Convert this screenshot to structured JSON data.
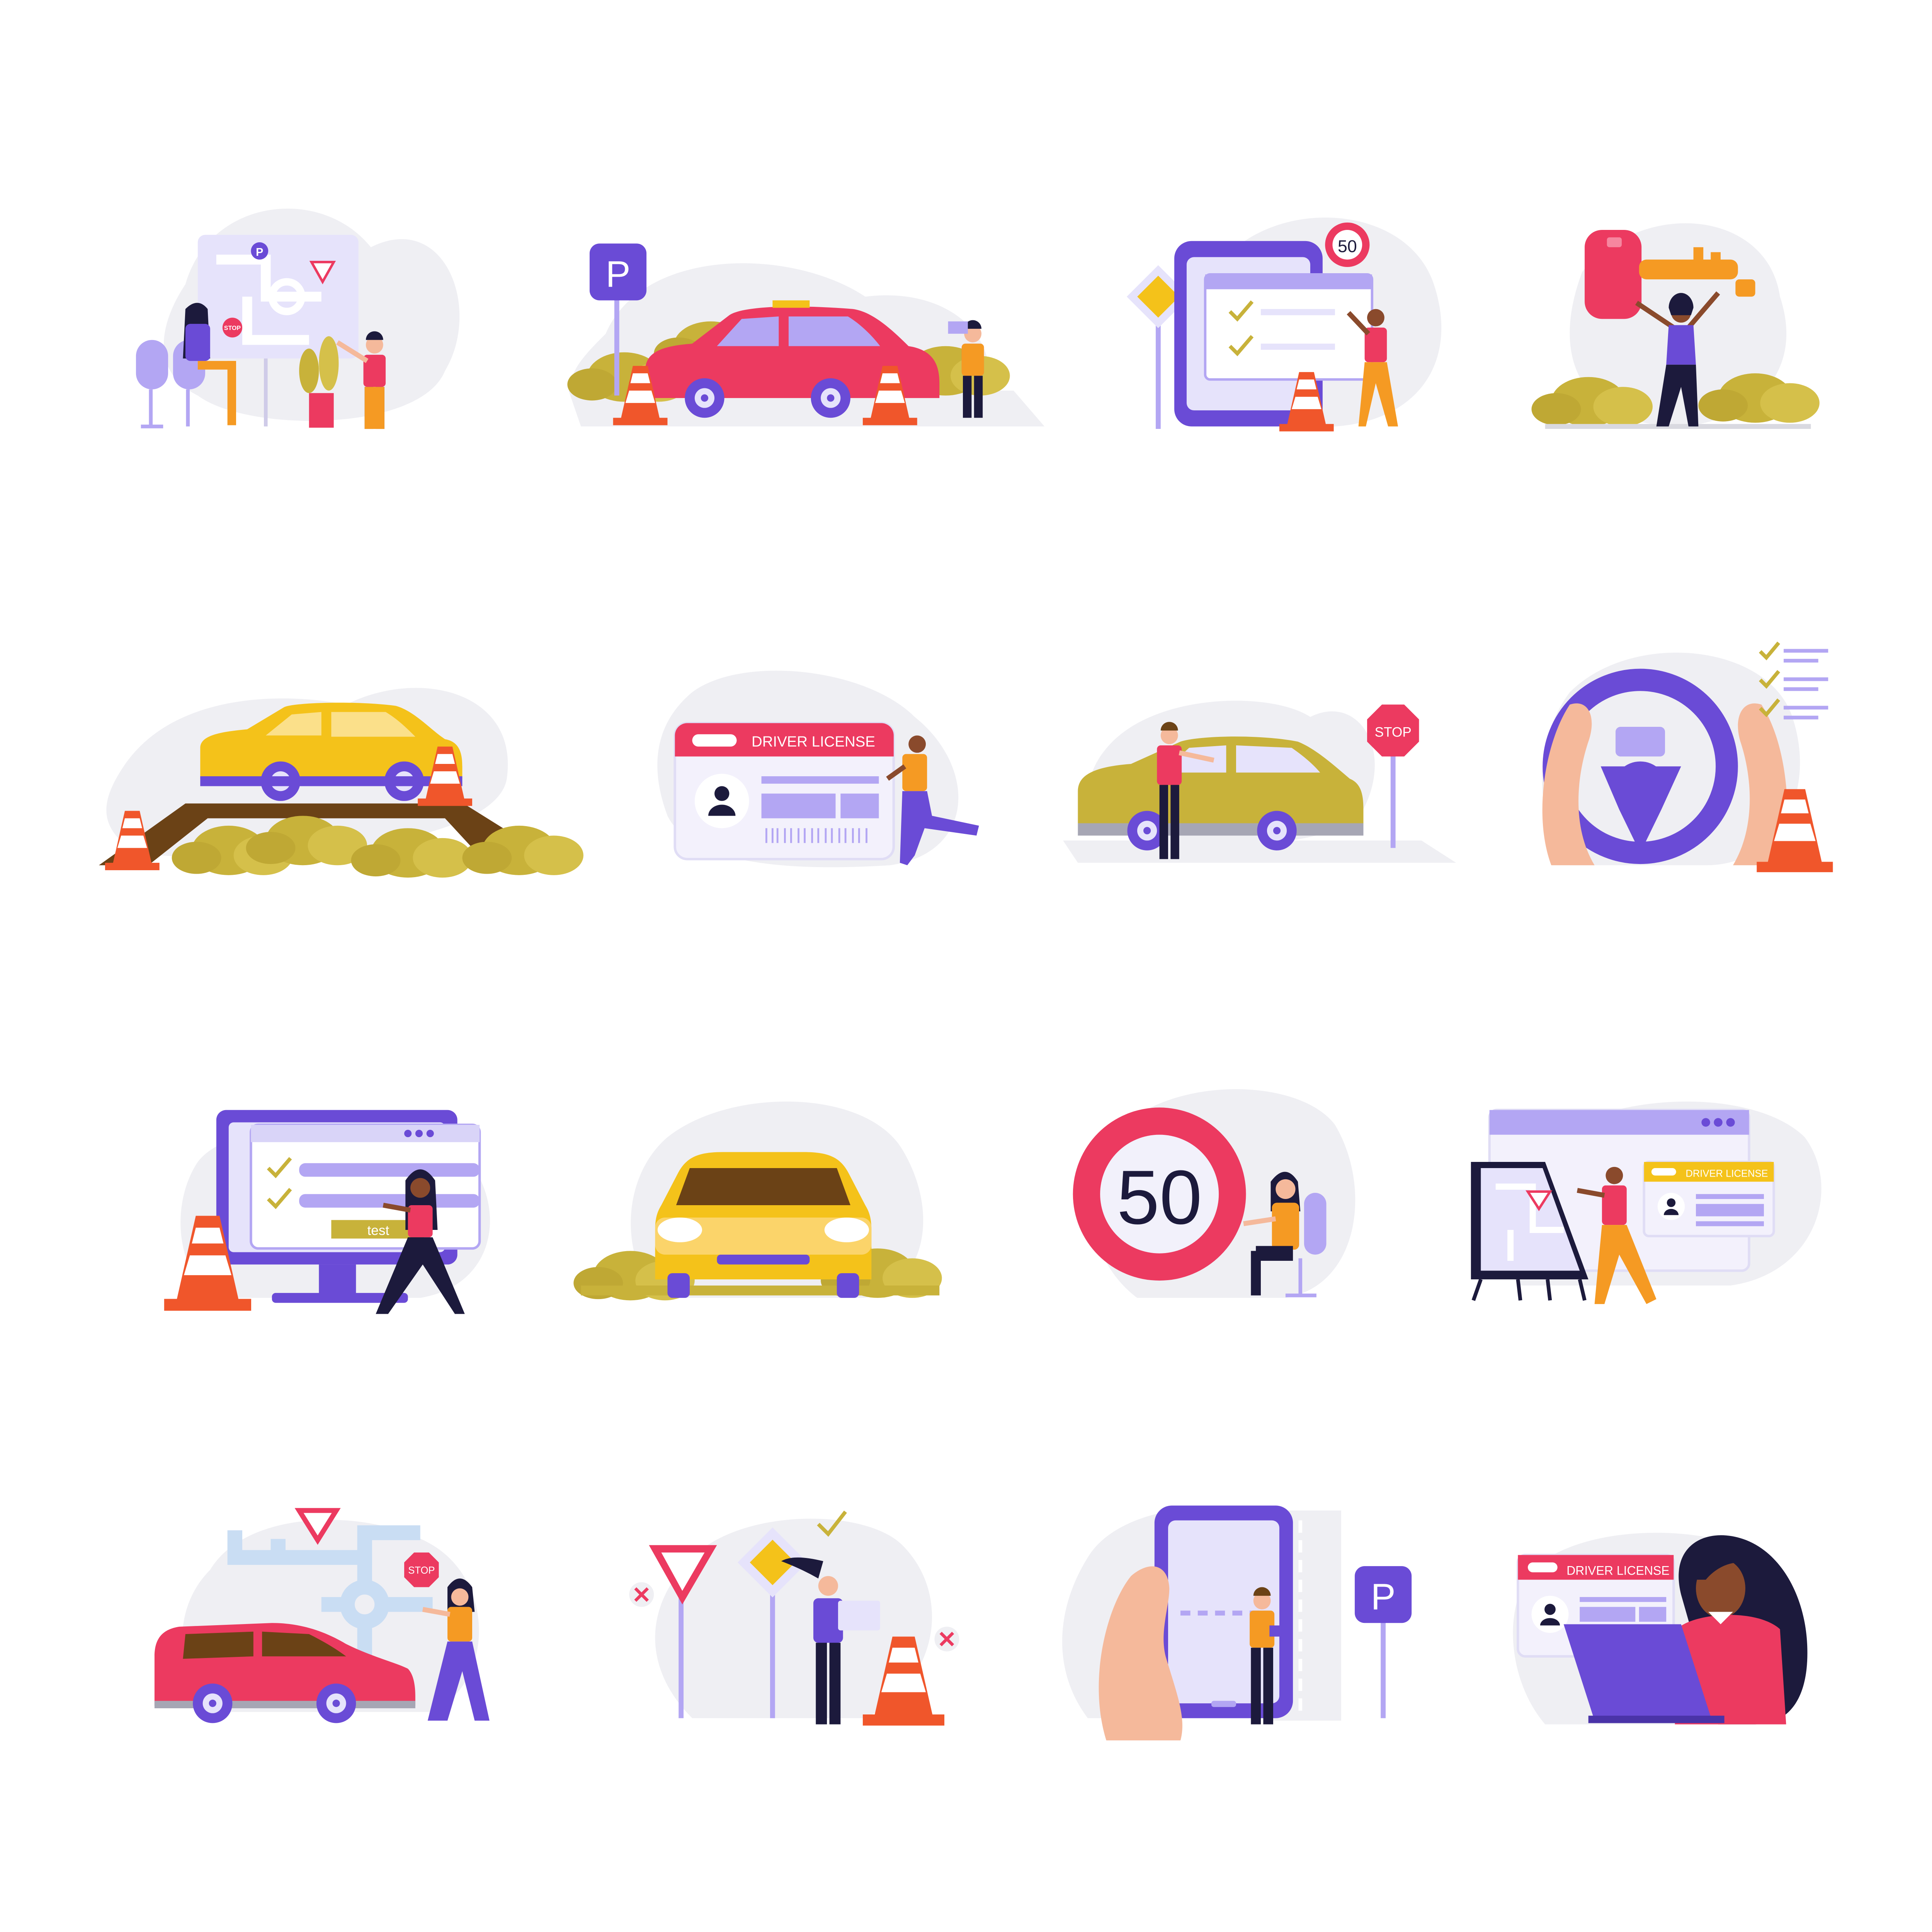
{
  "title": "",
  "labels": {
    "stop": "STOP",
    "speed": "50",
    "parking": "P",
    "driver_license": "DRIVER LICENSE",
    "test": "test"
  },
  "colors": {
    "purple": "#6a4bd6",
    "lavender": "#b3a6f3",
    "pale_lavender": "#e6e3fb",
    "red": "#ec3a60",
    "yellow": "#f4c21a",
    "orange": "#f59a23",
    "olive": "#c8b23a",
    "navy": "#1c1a3c",
    "skin": "#f5b99b",
    "dark_skin": "#8a4a2c",
    "cone": "#f0562b",
    "blob": "#efeff3"
  },
  "tiles": [
    {
      "name": "classroom-route-lesson",
      "icons": [
        "route-map-board",
        "parking-icon",
        "give-way-icon",
        "stop-sign-icon",
        "chair-icon",
        "plant-icon",
        "student-figure",
        "instructor-figure"
      ]
    },
    {
      "name": "parking-practice",
      "icons": [
        "parking-sign-icon",
        "red-car-icon",
        "traffic-cone-icon",
        "instructor-figure",
        "clipboard-icon"
      ]
    },
    {
      "name": "online-theory-test",
      "icons": [
        "tablet-icon",
        "speed-limit-icon",
        "checkmark-icon",
        "traffic-cone-icon",
        "diamond-sign-icon",
        "student-figure"
      ]
    },
    {
      "name": "car-key-celebration",
      "icons": [
        "car-key-icon",
        "bushes-icon",
        "woman-figure"
      ]
    },
    {
      "name": "overpass-driving",
      "icons": [
        "yellow-car-icon",
        "bridge-icon",
        "traffic-cone-icon",
        "bushes-icon"
      ]
    },
    {
      "name": "driver-license-card",
      "icons": [
        "driver-license-card",
        "avatar-icon",
        "barcode-icon",
        "running-man-figure"
      ]
    },
    {
      "name": "stop-sign-practice",
      "icons": [
        "olive-car-icon",
        "stop-sign-icon",
        "instructor-figure"
      ]
    },
    {
      "name": "steering-wheel-checklist",
      "icons": [
        "steering-wheel-icon",
        "hands-icon",
        "checklist-icon",
        "traffic-cone-icon"
      ]
    },
    {
      "name": "computer-test",
      "icons": [
        "monitor-icon",
        "checkmark-icon",
        "test-button",
        "traffic-cone-icon",
        "woman-figure"
      ]
    },
    {
      "name": "front-car-view",
      "icons": [
        "front-car-icon",
        "bushes-icon"
      ]
    },
    {
      "name": "speed-limit-study",
      "icons": [
        "speed-limit-icon",
        "chair-icon",
        "woman-figure"
      ]
    },
    {
      "name": "web-license-application",
      "icons": [
        "browser-window-icon",
        "map-easel-icon",
        "give-way-icon",
        "driver-license-card",
        "man-figure"
      ]
    },
    {
      "name": "route-red-car",
      "icons": [
        "route-map-icon",
        "give-way-icon",
        "stop-sign-icon",
        "red-car-icon",
        "woman-figure"
      ]
    },
    {
      "name": "road-signs-quiz",
      "icons": [
        "give-way-icon",
        "diamond-sign-icon",
        "cross-icon",
        "checkmark-icon",
        "traffic-cone-icon",
        "laptop-icon",
        "woman-figure"
      ]
    },
    {
      "name": "mobile-parking-app",
      "icons": [
        "phone-icon",
        "hand-icon",
        "parking-sign-icon",
        "man-figure"
      ]
    },
    {
      "name": "license-laptop-woman",
      "icons": [
        "driver-license-card",
        "avatar-icon",
        "laptop-icon",
        "woman-figure"
      ]
    }
  ]
}
